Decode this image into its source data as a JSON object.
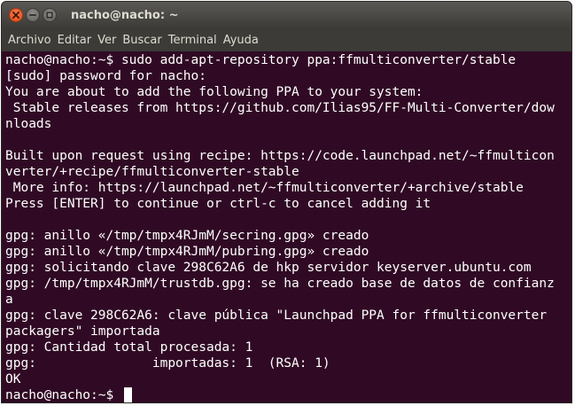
{
  "window": {
    "title": "nacho@nacho: ~"
  },
  "menubar": {
    "items": [
      "Archivo",
      "Editar",
      "Ver",
      "Buscar",
      "Terminal",
      "Ayuda"
    ]
  },
  "terminal": {
    "lines": [
      "nacho@nacho:~$ sudo add-apt-repository ppa:ffmulticonverter/stable",
      "[sudo] password for nacho:",
      "You are about to add the following PPA to your system:",
      " Stable releases from https://github.com/Ilias95/FF-Multi-Converter/dow",
      "nloads",
      "",
      "Built upon request using recipe: https://code.launchpad.net/~ffmulticon",
      "verter/+recipe/ffmulticonverter-stable",
      " More info: https://launchpad.net/~ffmulticonverter/+archive/stable",
      "Press [ENTER] to continue or ctrl-c to cancel adding it",
      "",
      "gpg: anillo «/tmp/tmpx4RJmM/secring.gpg» creado",
      "gpg: anillo «/tmp/tmpx4RJmM/pubring.gpg» creado",
      "gpg: solicitando clave 298C62A6 de hkp servidor keyserver.ubuntu.com",
      "gpg: /tmp/tmpx4RJmM/trustdb.gpg: se ha creado base de datos de confianz",
      "a",
      "gpg: clave 298C62A6: clave pública \"Launchpad PPA for ffmulticonverter",
      "packagers\" importada",
      "gpg: Cantidad total procesada: 1",
      "gpg:               importadas: 1  (RSA: 1)",
      "OK"
    ],
    "prompt": "nacho@nacho:~$ "
  },
  "colors": {
    "terminal_bg": "#300a24",
    "terminal_fg": "#ffffff",
    "titlebar_bg": "#3c3b37",
    "close_button": "#df4a16"
  }
}
